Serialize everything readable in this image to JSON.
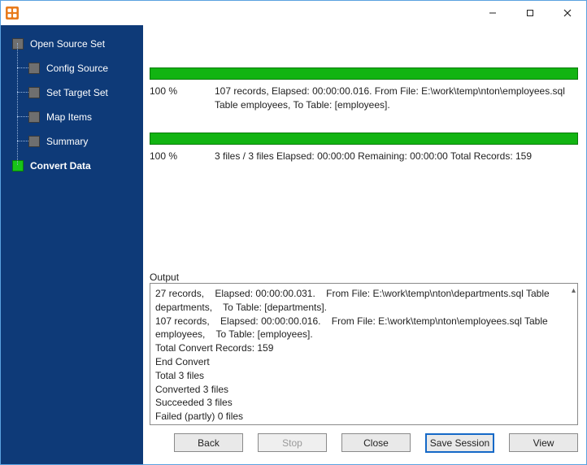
{
  "window": {
    "minimize": "—",
    "maximize": "▢",
    "close": "✕"
  },
  "sidebar": {
    "steps": [
      {
        "label": "Open Source Set"
      },
      {
        "label": "Config Source"
      },
      {
        "label": "Set Target Set"
      },
      {
        "label": "Map Items"
      },
      {
        "label": "Summary"
      },
      {
        "label": "Convert Data"
      }
    ]
  },
  "progress1": {
    "percent": "100 %",
    "line1": "107 records,    Elapsed: 00:00:00.016.    From File: E:\\work\\temp\\nton\\employees.sql Table employees,    To Table: [employees]."
  },
  "progress2": {
    "percent": "100 %",
    "line1": "3 files / 3 files    Elapsed: 00:00:00    Remaining: 00:00:00    Total Records: 159"
  },
  "output": {
    "label": "Output",
    "text": "27 records,    Elapsed: 00:00:00.031.    From File: E:\\work\\temp\\nton\\departments.sql Table departments,    To Table: [departments].\n107 records,    Elapsed: 00:00:00.016.    From File: E:\\work\\temp\\nton\\employees.sql Table employees,    To Table: [employees].\nTotal Convert Records: 159\nEnd Convert\nTotal 3 files\nConverted 3 files\nSucceeded 3 files\nFailed (partly) 0 files"
  },
  "buttons": {
    "back": "Back",
    "stop": "Stop",
    "close": "Close",
    "save_session": "Save Session",
    "view": "View"
  }
}
